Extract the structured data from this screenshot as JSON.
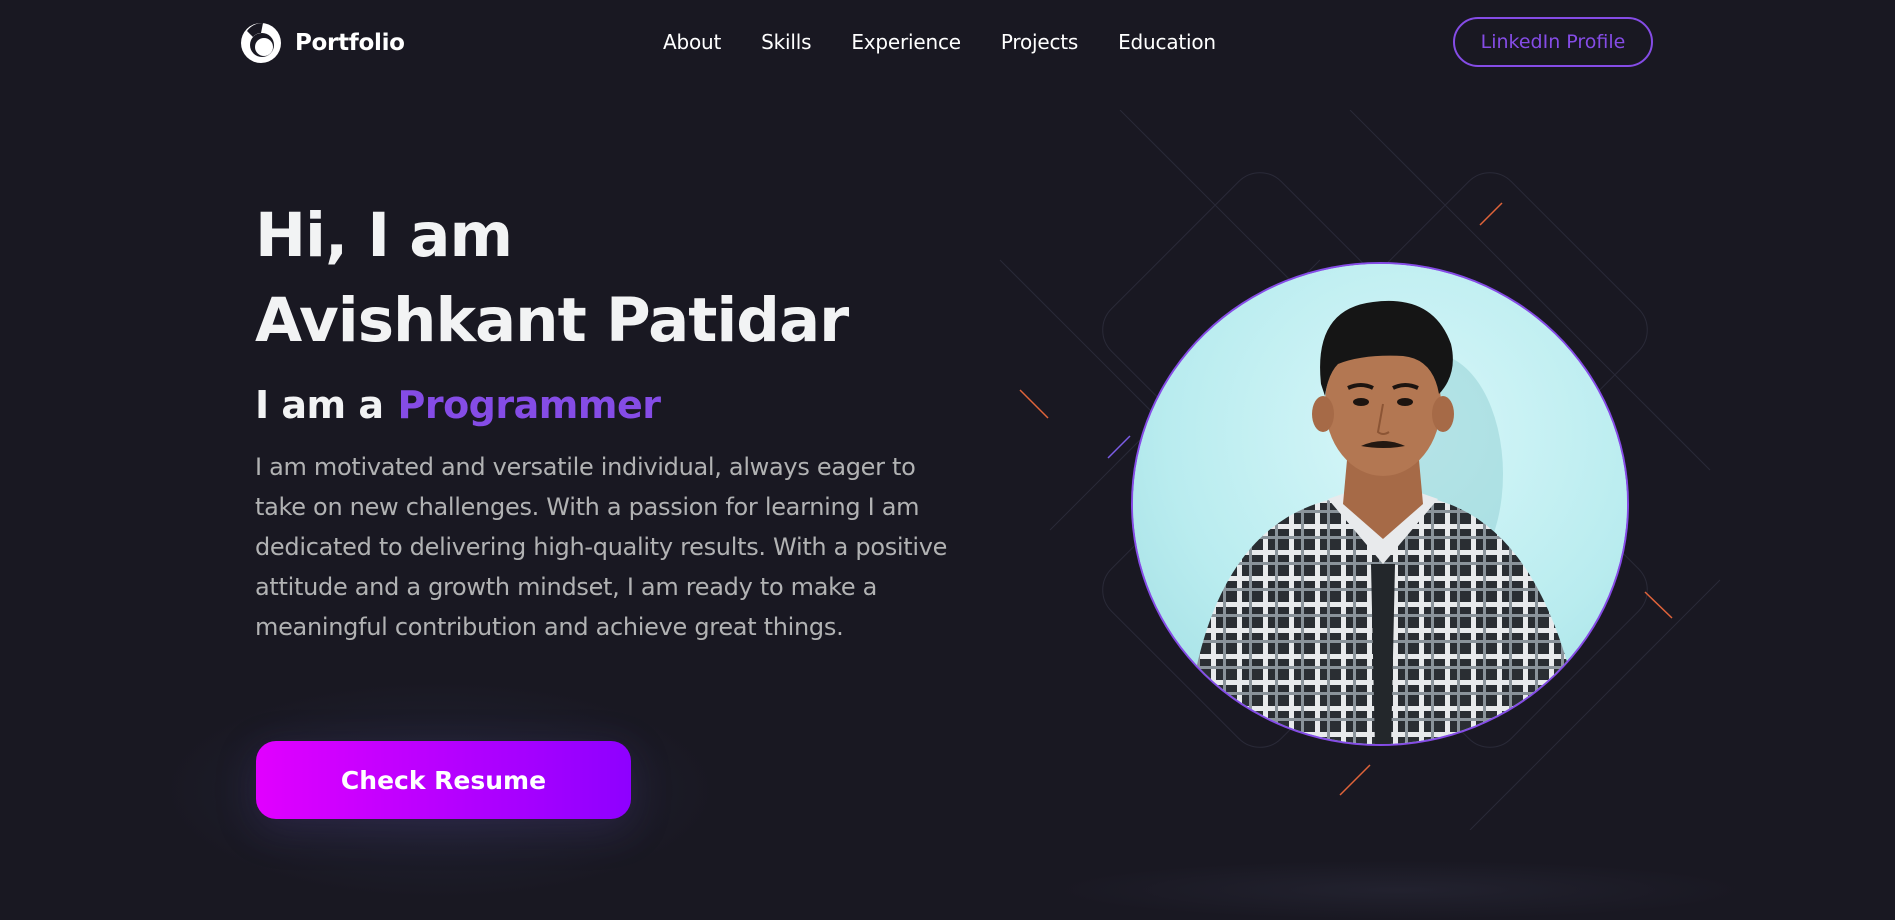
{
  "nav": {
    "logo_text": "Portfolio",
    "links": [
      {
        "label": "About"
      },
      {
        "label": "Skills"
      },
      {
        "label": "Experience"
      },
      {
        "label": "Projects"
      },
      {
        "label": "Education"
      }
    ],
    "linkedin_label": "LinkedIn Profile"
  },
  "hero": {
    "greeting": "Hi, I am",
    "name": "Avishkant Patidar",
    "role_prefix": "I am a",
    "role": "Programmer",
    "description": "I am motivated and versatile individual, always eager to take on new challenges. With a passion for learning I am dedicated to delivering high-quality results. With a positive attitude and a growth mindset, I am ready to make a meaningful contribution and achieve great things.",
    "resume_label": "Check Resume"
  },
  "colors": {
    "background": "#191822",
    "accent": "#854ce6",
    "text_primary": "#f2f3f4",
    "text_secondary": "#b1b2b3",
    "button_gradient_start": "#e100ff",
    "button_gradient_end": "#8e00ff"
  },
  "icons": {
    "logo": "portfolio-logo-icon"
  }
}
